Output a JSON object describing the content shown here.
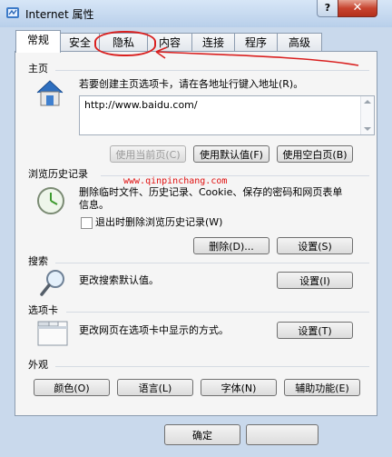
{
  "window": {
    "title": "Internet 属性",
    "help_label": "?",
    "close_label": "✕"
  },
  "tabs": [
    {
      "label": "常规",
      "active": true
    },
    {
      "label": "安全",
      "active": false
    },
    {
      "label": "隐私",
      "active": false
    },
    {
      "label": "内容",
      "active": false
    },
    {
      "label": "连接",
      "active": false
    },
    {
      "label": "程序",
      "active": false
    },
    {
      "label": "高级",
      "active": false
    }
  ],
  "homepage": {
    "section_label": "主页",
    "description": "若要创建主页选项卡，请在各地址行键入地址(R)。",
    "value": "http://www.baidu.com/",
    "use_current": "使用当前页(C)",
    "use_default": "使用默认值(F)",
    "use_blank": "使用空白页(B)"
  },
  "history": {
    "section_label": "浏览历史记录",
    "description": "删除临时文件、历史记录、Cookie、保存的密码和网页表单信息。",
    "checkbox_label": "退出时删除浏览历史记录(W)",
    "checkbox_checked": false,
    "delete_button": "删除(D)...",
    "settings_button": "设置(S)"
  },
  "watermark_text": "www.qinpinchang.com",
  "search": {
    "section_label": "搜索",
    "description": "更改搜索默认值。",
    "settings_button": "设置(I)"
  },
  "tabs_section": {
    "section_label": "选项卡",
    "description": "更改网页在选项卡中显示的方式。",
    "settings_button": "设置(T)"
  },
  "appearance": {
    "section_label": "外观",
    "colors_button": "颜色(O)",
    "languages_button": "语言(L)",
    "fonts_button": "字体(N)",
    "accessibility_button": "辅助功能(E)"
  },
  "footer": {
    "ok_button": "确定"
  }
}
